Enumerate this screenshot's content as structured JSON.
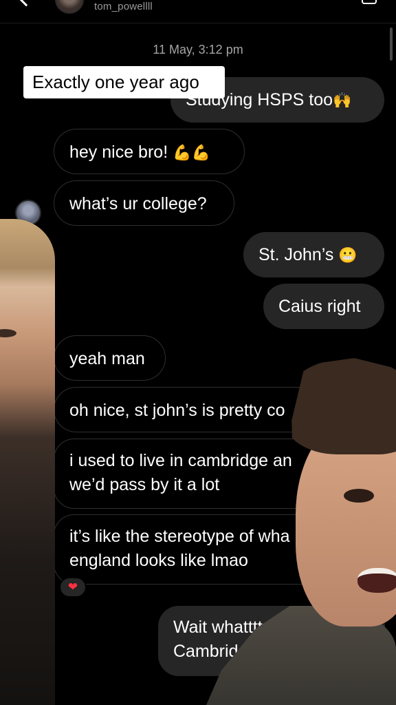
{
  "header": {
    "username": "tom_powellll"
  },
  "timestamp": "11 May, 3:12 pm",
  "caption": "Exactly one year ago",
  "messages": [
    {
      "text": "Studying HSPS too",
      "emoji": "🙌"
    },
    {
      "text": "hey nice bro! ",
      "emoji": "💪💪"
    },
    {
      "text": "what’s ur college?"
    },
    {
      "text": "St. John’s ",
      "emoji": "😬"
    },
    {
      "text": "Caius right"
    },
    {
      "text": "yeah man"
    },
    {
      "text": "oh nice, st john’s is pretty co"
    },
    {
      "line1": "i used to live in cambridge an",
      "line2": "we’d pass by it a lot"
    },
    {
      "line1": "it’s like the stereotype of wha",
      "line2": "england looks like lmao"
    },
    {
      "line1": "Wait whatttt u l",
      "line2": "Cambridge"
    }
  ],
  "reaction": "❤",
  "icons": {
    "back": "back-chevron-icon",
    "video": "video-call-icon",
    "heart": "heart-reaction-icon"
  },
  "colors": {
    "background": "#000000",
    "incoming_border": "#2f2f2f",
    "outgoing_bubble": "#262626",
    "caption_bg": "#ffffff",
    "heart": "#ff3040"
  }
}
